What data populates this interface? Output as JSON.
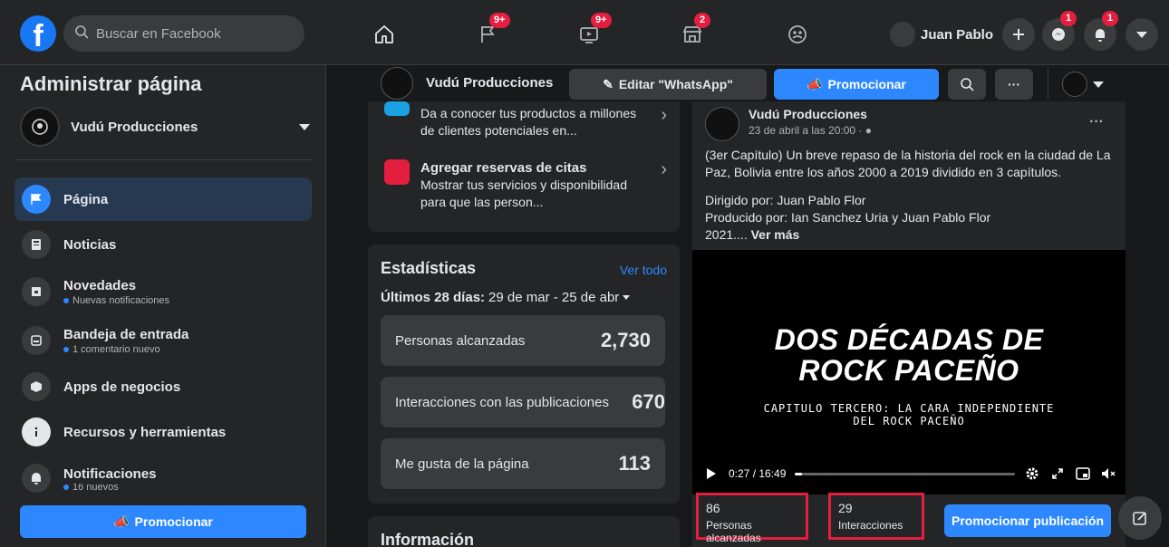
{
  "topbar": {
    "logo": "f",
    "search_placeholder": "Buscar en Facebook",
    "nav": [
      {
        "icon": "home-icon",
        "badge": ""
      },
      {
        "icon": "flag-icon",
        "badge": "9+"
      },
      {
        "icon": "video-icon",
        "badge": "9+"
      },
      {
        "icon": "marketplace-icon",
        "badge": "2"
      },
      {
        "icon": "groups-icon",
        "badge": ""
      }
    ],
    "profile_name": "Juan Pablo",
    "messenger_badge": "1",
    "notifications_badge": "1"
  },
  "sidebar": {
    "title": "Administrar página",
    "page_name": "Vudú Producciones",
    "items": [
      {
        "label": "Página",
        "sub": "",
        "icon": "flag-icon"
      },
      {
        "label": "Noticias",
        "sub": "",
        "icon": "news-icon"
      },
      {
        "label": "Novedades",
        "sub": "Nuevas notificaciones",
        "icon": "inbox-icon"
      },
      {
        "label": "Bandeja de entrada",
        "sub": "1 comentario nuevo",
        "icon": "message-icon"
      },
      {
        "label": "Apps de negocios",
        "sub": "",
        "icon": "cube-icon"
      },
      {
        "label": "Recursos y herramientas",
        "sub": "",
        "icon": "info-icon"
      },
      {
        "label": "Notificaciones",
        "sub": "16 nuevos",
        "icon": "bell-icon"
      }
    ],
    "promote_label": "Promocionar"
  },
  "page_header": {
    "name": "Vudú Producciones",
    "edit_label": "Editar \"WhatsApp\"",
    "promote_label": "Promocionar",
    "more_label": "···"
  },
  "promo_items": [
    {
      "title": "",
      "desc": "Da a conocer tus productos a millones de clientes potenciales en..."
    },
    {
      "title": "Agregar reservas de citas",
      "desc": "Mostrar tus servicios y disponibilidad para que las person..."
    }
  ],
  "stats": {
    "title": "Estadísticas",
    "see_all": "Ver todo",
    "period_label": "Últimos 28 días:",
    "period_range": "29 de mar - 25 de abr",
    "rows": [
      {
        "label": "Personas alcanzadas",
        "value": "2,730"
      },
      {
        "label": "Interacciones con las publicaciones",
        "value": "670"
      },
      {
        "label": "Me gusta de la página",
        "value": "113"
      }
    ]
  },
  "info": {
    "title": "Información"
  },
  "post": {
    "author": "Vudú Producciones",
    "date": "23 de abril a las 20:00 · ",
    "more": "···",
    "text1": "(3er Capítulo) Un breve repaso de la historia del rock en la ciudad de La Paz, Bolivia entre los años 2000 a 2019 dividido en 3 capítulos.",
    "text2_line1": "Dirigido por: Juan Pablo Flor",
    "text2_line2": "Producido por: Ian Sanchez Uria y Juan Pablo Flor",
    "text2_line3": "2021....",
    "see_more": "Ver más",
    "video_title_1": "DOS DÉCADAS DE",
    "video_title_2": "ROCK PACEÑO",
    "video_sub_1": "CAPITULO TERCERO: LA CARA INDEPENDIENTE",
    "video_sub_2": "DEL ROCK PACEÑO",
    "time": "0:27 / 16:49",
    "progress": 0.03,
    "reach_value": "86",
    "reach_label": "Personas alcanzadas",
    "interactions_value": "29",
    "interactions_label": "Interacciones",
    "boost_label": "Promocionar publicación"
  },
  "colors": {
    "accent": "#2d88ff",
    "highlight": "#e41e3f",
    "background": "#18191a",
    "surface": "#242526"
  }
}
